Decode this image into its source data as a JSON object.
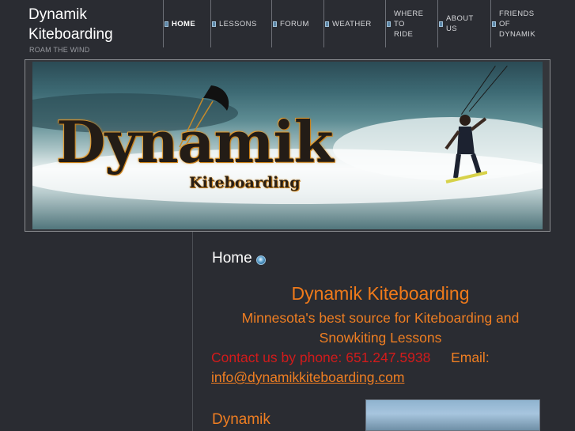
{
  "site": {
    "title": "Dynamik Kiteboarding",
    "tagline": "ROAM THE WIND"
  },
  "nav": {
    "items": [
      {
        "label": "HOME",
        "active": true
      },
      {
        "label": "LESSONS"
      },
      {
        "label": "FORUM"
      },
      {
        "label": "WEATHER"
      },
      {
        "label": "WHERE\nTO\nRIDE"
      },
      {
        "label": "ABOUT\nUS"
      },
      {
        "label": "FRIENDS\nOF\nDYNAMIK"
      }
    ]
  },
  "banner": {
    "logo_text": "Dynamik",
    "logo_subtext": "Kiteboarding"
  },
  "main": {
    "page_heading": "Home",
    "company_title": "Dynamik Kiteboarding",
    "subtitle": "Minnesota's best source for Kiteboarding and Snowkiting Lessons",
    "contact_phone": "Contact us by phone:  651.247.5938",
    "contact_email_label": "Email:",
    "email": "info@dynamikkiteboarding.com",
    "section_label": "Dynamik"
  },
  "colors": {
    "background": "#2a2c32",
    "accent_orange": "#ef7e22",
    "contact_red": "#d21b1b"
  }
}
